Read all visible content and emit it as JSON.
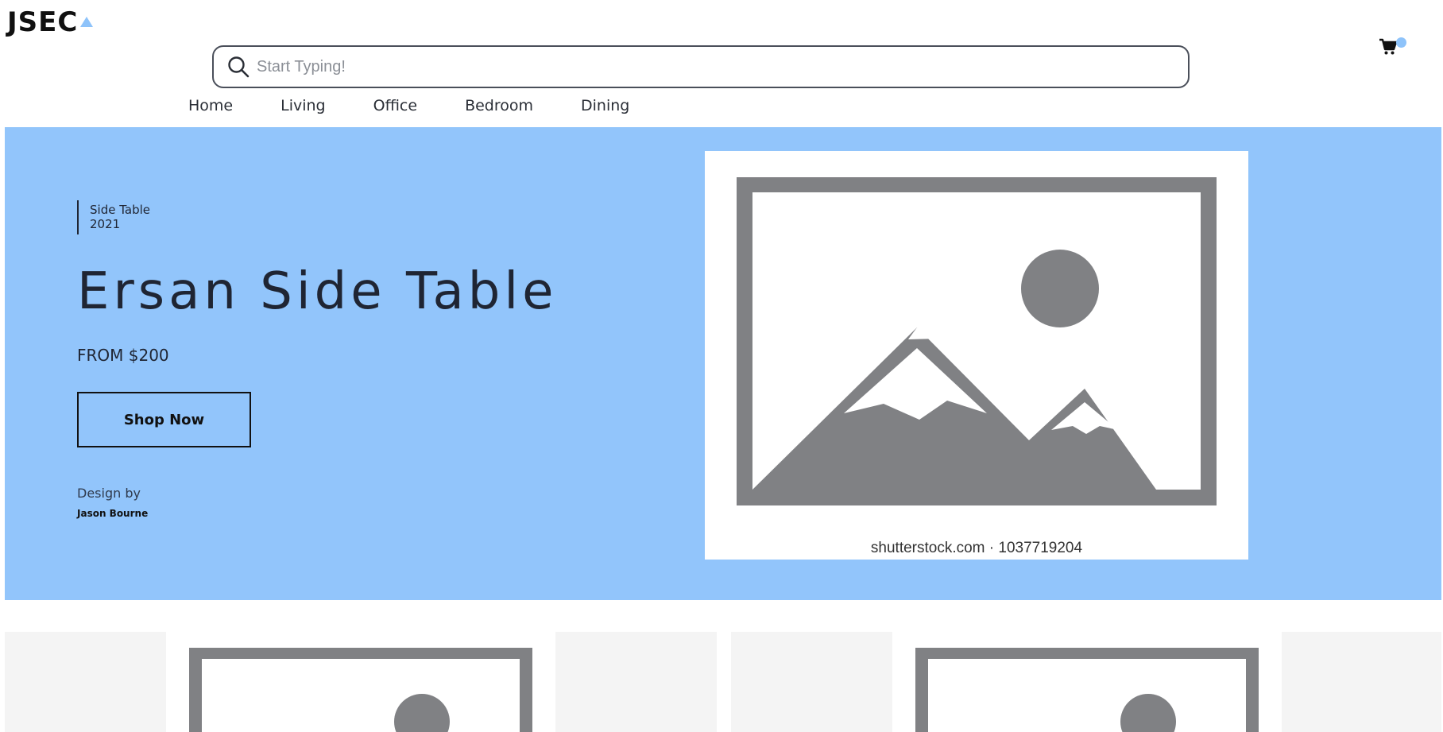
{
  "header": {
    "logo_text": "JSEC",
    "search_placeholder": "Start Typing!",
    "search_value": ""
  },
  "nav": {
    "items": [
      "Home",
      "Living",
      "Office",
      "Bedroom",
      "Dining"
    ]
  },
  "hero": {
    "eyebrow_line1": "Side Table",
    "eyebrow_line2": "2021",
    "title": "Ersan Side Table",
    "price": "FROM $200",
    "cta_label": "Shop Now",
    "design_by_label": "Design by",
    "designer": "Jason Bourne",
    "image_watermark": "shutterstock.com · 1037719204"
  },
  "colors": {
    "hero_background": "#92c5fb",
    "accent": "#8ec3fa",
    "placeholder_gray": "#808184",
    "tile_background": "#f4f4f4"
  },
  "icons": {
    "search": "search-icon",
    "cart": "cart-icon"
  }
}
